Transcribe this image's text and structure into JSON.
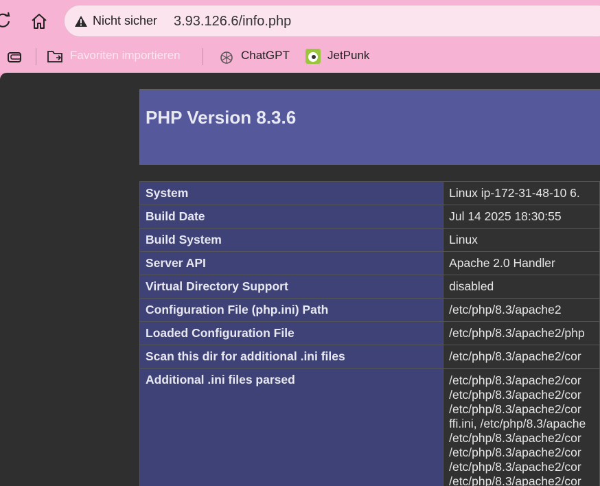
{
  "browser": {
    "security_label": "Nicht sicher",
    "url": "3.93.126.6/info.php",
    "bookmarks": [
      {
        "label": "Favoriten importieren",
        "icon": "folder-import-icon"
      },
      {
        "label": "ChatGPT",
        "icon": "chatgpt-icon"
      },
      {
        "label": "JetPunk",
        "icon": "jetpunk-icon"
      }
    ]
  },
  "php": {
    "title": "PHP Version 8.3.6",
    "rows": [
      {
        "key": "System",
        "value": "Linux ip-172-31-48-10 6."
      },
      {
        "key": "Build Date",
        "value": "Jul 14 2025 18:30:55"
      },
      {
        "key": "Build System",
        "value": "Linux"
      },
      {
        "key": "Server API",
        "value": "Apache 2.0 Handler"
      },
      {
        "key": "Virtual Directory Support",
        "value": "disabled"
      },
      {
        "key": "Configuration File (php.ini) Path",
        "value": "/etc/php/8.3/apache2"
      },
      {
        "key": "Loaded Configuration File",
        "value": "/etc/php/8.3/apache2/php"
      },
      {
        "key": "Scan this dir for additional .ini files",
        "value": "/etc/php/8.3/apache2/cor"
      },
      {
        "key": "Additional .ini files parsed",
        "lines": [
          "/etc/php/8.3/apache2/cor",
          "/etc/php/8.3/apache2/cor",
          "/etc/php/8.3/apache2/cor",
          "ffi.ini, /etc/php/8.3/apache",
          "/etc/php/8.3/apache2/cor",
          "/etc/php/8.3/apache2/cor",
          "/etc/php/8.3/apache2/cor",
          "/etc/php/8.3/apache2/cor"
        ]
      }
    ]
  }
}
